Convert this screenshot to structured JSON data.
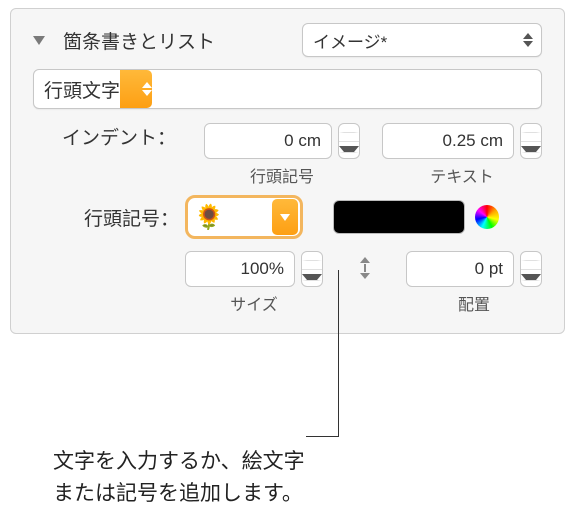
{
  "header": {
    "title": "箇条書きとリスト",
    "style_popup": "イメージ*"
  },
  "type_popup": "行頭文字",
  "indent": {
    "label": "インデント：",
    "bullet_indent": "0 cm",
    "bullet_sublabel": "行頭記号",
    "text_indent": "0.25 cm",
    "text_sublabel": "テキスト"
  },
  "bullet": {
    "label": "行頭記号：",
    "emoji": "🌻"
  },
  "size": {
    "value": "100%",
    "label": "サイズ"
  },
  "align": {
    "value": "0 pt",
    "label": "配置"
  },
  "callout": {
    "line1": "文字を入力するか、絵文字",
    "line2": "または記号を追加します。"
  }
}
